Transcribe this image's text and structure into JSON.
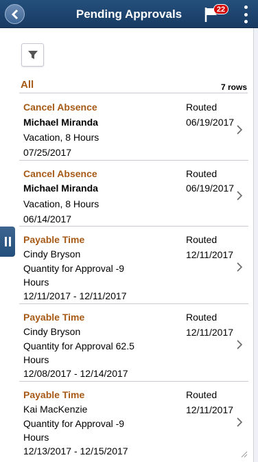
{
  "header": {
    "title": "Pending Approvals",
    "notification_count": "22",
    "back_icon": "chevron-left-icon",
    "flag_icon": "flag-icon",
    "menu_icon": "vertical-ellipsis-icon"
  },
  "list": {
    "title": "All",
    "row_count": "7 rows",
    "filter_icon": "filter-icon",
    "items": [
      {
        "type": "Cancel Absence",
        "name": "Michael Miranda",
        "detail": "Vacation, 8 Hours",
        "detail2": "",
        "date_line": "07/25/2017",
        "status": "Routed",
        "date": "06/19/2017"
      },
      {
        "type": "Cancel Absence",
        "name": "Michael Miranda",
        "detail": "Vacation, 8 Hours",
        "detail2": "",
        "date_line": "06/14/2017",
        "status": "Routed",
        "date": "06/19/2017"
      },
      {
        "type": "Payable Time",
        "name": "Cindy Bryson",
        "detail": "Quantity for Approval -9",
        "detail2": "Hours",
        "date_line": "12/11/2017 - 12/11/2017",
        "status": "Routed",
        "date": "12/11/2017"
      },
      {
        "type": "Payable Time",
        "name": "Cindy Bryson",
        "detail": "Quantity for Approval 62.5",
        "detail2": "Hours",
        "date_line": "12/08/2017 - 12/14/2017",
        "status": "Routed",
        "date": "12/11/2017"
      },
      {
        "type": "Payable Time",
        "name": "Kai MacKenzie",
        "detail": "Quantity for Approval -9",
        "detail2": "Hours",
        "date_line": "12/13/2017 - 12/15/2017",
        "status": "Routed",
        "date": "12/11/2017"
      }
    ]
  },
  "colors": {
    "header": "#1f4670",
    "accent": "#a65a16",
    "badge": "#d40000"
  }
}
